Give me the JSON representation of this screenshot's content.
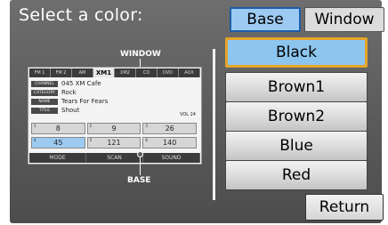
{
  "title": "Select a color:",
  "callouts": {
    "window": "WINDOW",
    "base": "BASE"
  },
  "tabs": [
    {
      "label": "Base",
      "selected": true
    },
    {
      "label": "Window",
      "selected": false
    }
  ],
  "colors": [
    {
      "label": "Black",
      "selected": true
    },
    {
      "label": "Brown1",
      "selected": false
    },
    {
      "label": "Brown2",
      "selected": false
    },
    {
      "label": "Blue",
      "selected": false
    },
    {
      "label": "Red",
      "selected": false
    }
  ],
  "return_label": "Return",
  "preview": {
    "tabs": [
      "FM 1",
      "FM 2",
      "AM",
      "XM1",
      "XM2",
      "CD",
      "DVD",
      "AUX"
    ],
    "selected_tab": "XM1",
    "info": [
      {
        "label": "CHANNEL",
        "value": "045  XM Cafe"
      },
      {
        "label": "CATEGORY",
        "value": "Rock"
      },
      {
        "label": "NAME",
        "value": "Tears For Fears"
      },
      {
        "label": "TITLE",
        "value": "Shout"
      }
    ],
    "volume": "VOL 24",
    "presets": [
      {
        "num": "1",
        "value": "8"
      },
      {
        "num": "2",
        "value": "9"
      },
      {
        "num": "3",
        "value": "26"
      },
      {
        "num": "4",
        "value": "45"
      },
      {
        "num": "5",
        "value": "121"
      },
      {
        "num": "6",
        "value": "140"
      }
    ],
    "selected_preset": "4",
    "bottom_buttons": [
      "MODE",
      "SCAN",
      "SOUND"
    ]
  },
  "colors_theme": {
    "screen_bg": "#5a5a5a",
    "selected_blue": "#9dcaf2",
    "selection_border": "#e5a52a",
    "button_gray": "#d8d8d8"
  }
}
